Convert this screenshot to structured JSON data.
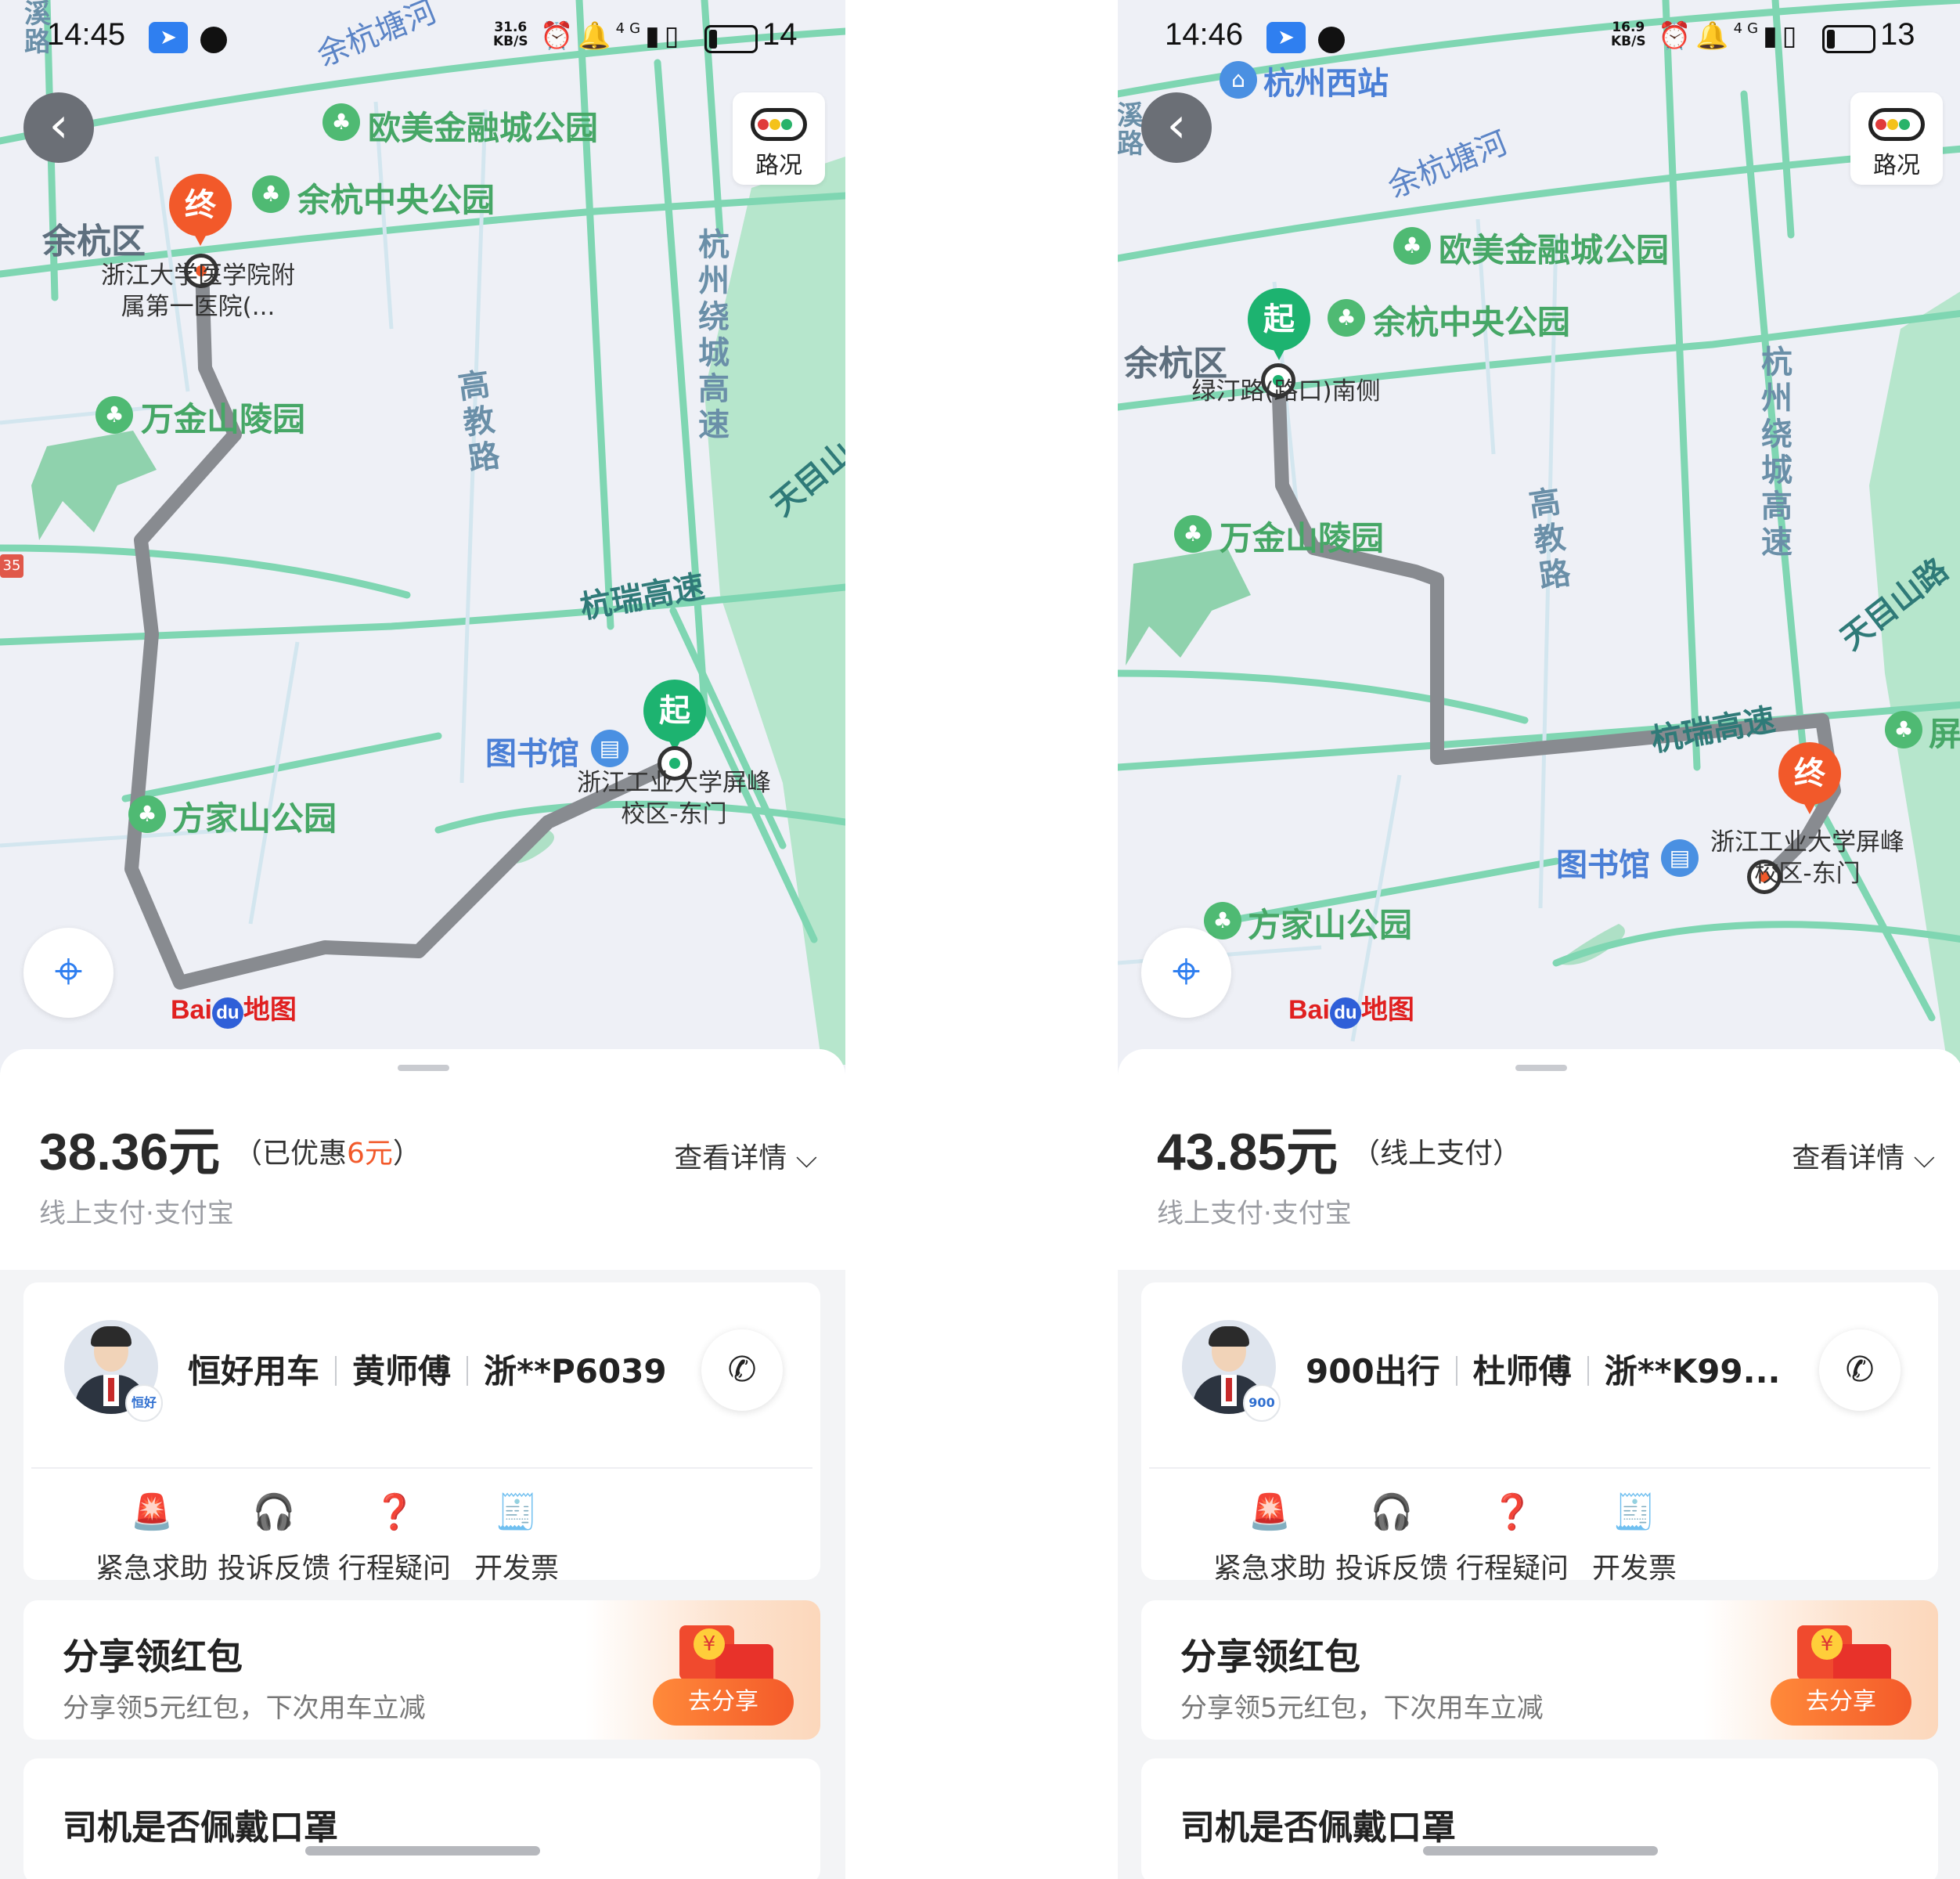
{
  "screens": [
    {
      "status_bar": {
        "time": "14:45",
        "net_speed_value": "31.6",
        "net_speed_unit": "KB/S",
        "signal": "4G",
        "battery": "14"
      },
      "map": {
        "traffic_label": "路况",
        "district": "余杭区",
        "water": [
          "余杭塘河"
        ],
        "roads_horizontal": [
          "杭瑞高速"
        ],
        "roads_vertical": [
          "杭州绕城高速",
          "高教路"
        ],
        "roads_partial": [
          "天目山",
          "溪路"
        ],
        "pois": [
          "欧美金融城公园",
          "余杭中央公园",
          "万金山陵园",
          "方家山公园"
        ],
        "library": "图书馆",
        "end_pin": {
          "mark": "终",
          "label": "浙江大学医学院附属第一医院(..."
        },
        "start_pin": {
          "mark": "起",
          "label": "浙江工业大学屏峰校区-东门"
        },
        "road_badge": "35",
        "brand": {
          "bai": "Bai",
          "du": "du",
          "ditu": "地图"
        }
      },
      "fare": {
        "amount": "38.36元",
        "note_prefix": "（已优惠",
        "note_highlight": "6元",
        "note_suffix": "）",
        "details": "查看详情",
        "pay_method": "线上支付·支付宝"
      },
      "driver": {
        "company": "恒好用车",
        "name": "黄师傅",
        "plate": "浙**P6039",
        "badge": "恒好"
      },
      "actions": [
        "紧急求助",
        "投诉反馈",
        "行程疑问",
        "开发票"
      ],
      "share": {
        "title": "分享领红包",
        "subtitle": "分享领5元红包，下次用车立减",
        "button": "去分享",
        "coin": "¥"
      },
      "next_card_title": "司机是否佩戴口罩"
    },
    {
      "status_bar": {
        "time": "14:46",
        "net_speed_value": "16.9",
        "net_speed_unit": "KB/S",
        "signal": "4G",
        "battery": "13"
      },
      "map": {
        "traffic_label": "路况",
        "district": "余杭区",
        "station": "杭州西站",
        "water": [
          "余杭塘河"
        ],
        "roads_horizontal": [
          "杭瑞高速",
          "天目山路"
        ],
        "roads_vertical": [
          "杭州绕城高速",
          "高教路"
        ],
        "roads_partial": [
          "溪路"
        ],
        "pois": [
          "欧美金融城公园",
          "余杭中央公园",
          "万金山陵园",
          "方家山公园",
          "屏"
        ],
        "library": "图书馆",
        "start_pin": {
          "mark": "起",
          "label": "绿汀路(路口)南侧"
        },
        "end_pin": {
          "mark": "终",
          "label": "浙江工业大学屏峰校区-东门"
        },
        "brand": {
          "bai": "Bai",
          "du": "du",
          "ditu": "地图"
        }
      },
      "fare": {
        "amount": "43.85元",
        "note_prefix": "（线上支付）",
        "details": "查看详情",
        "pay_method": "线上支付·支付宝"
      },
      "driver": {
        "company": "900出行",
        "name": "杜师傅",
        "plate": "浙**K99...",
        "badge": "900"
      },
      "actions": [
        "紧急求助",
        "投诉反馈",
        "行程疑问",
        "开发票"
      ],
      "share": {
        "title": "分享领红包",
        "subtitle": "分享领5元红包，下次用车立减",
        "button": "去分享",
        "coin": "¥"
      },
      "next_card_title": "司机是否佩戴口罩"
    }
  ],
  "icons": {
    "back": "chevron-left-icon",
    "traffic": "traffic-light-icon",
    "locate": "locate-icon",
    "phone": "phone-icon",
    "actions": [
      "siren-icon",
      "headset-icon",
      "question-icon",
      "invoice-icon"
    ]
  },
  "colors": {
    "route": "#888b90",
    "start_pin": "#1db370",
    "end_pin": "#f2592a",
    "discount": "#f2592a",
    "share_button": "#f45a2a",
    "map_road": "#7fd6b2",
    "map_green": "#b6e6cc"
  }
}
